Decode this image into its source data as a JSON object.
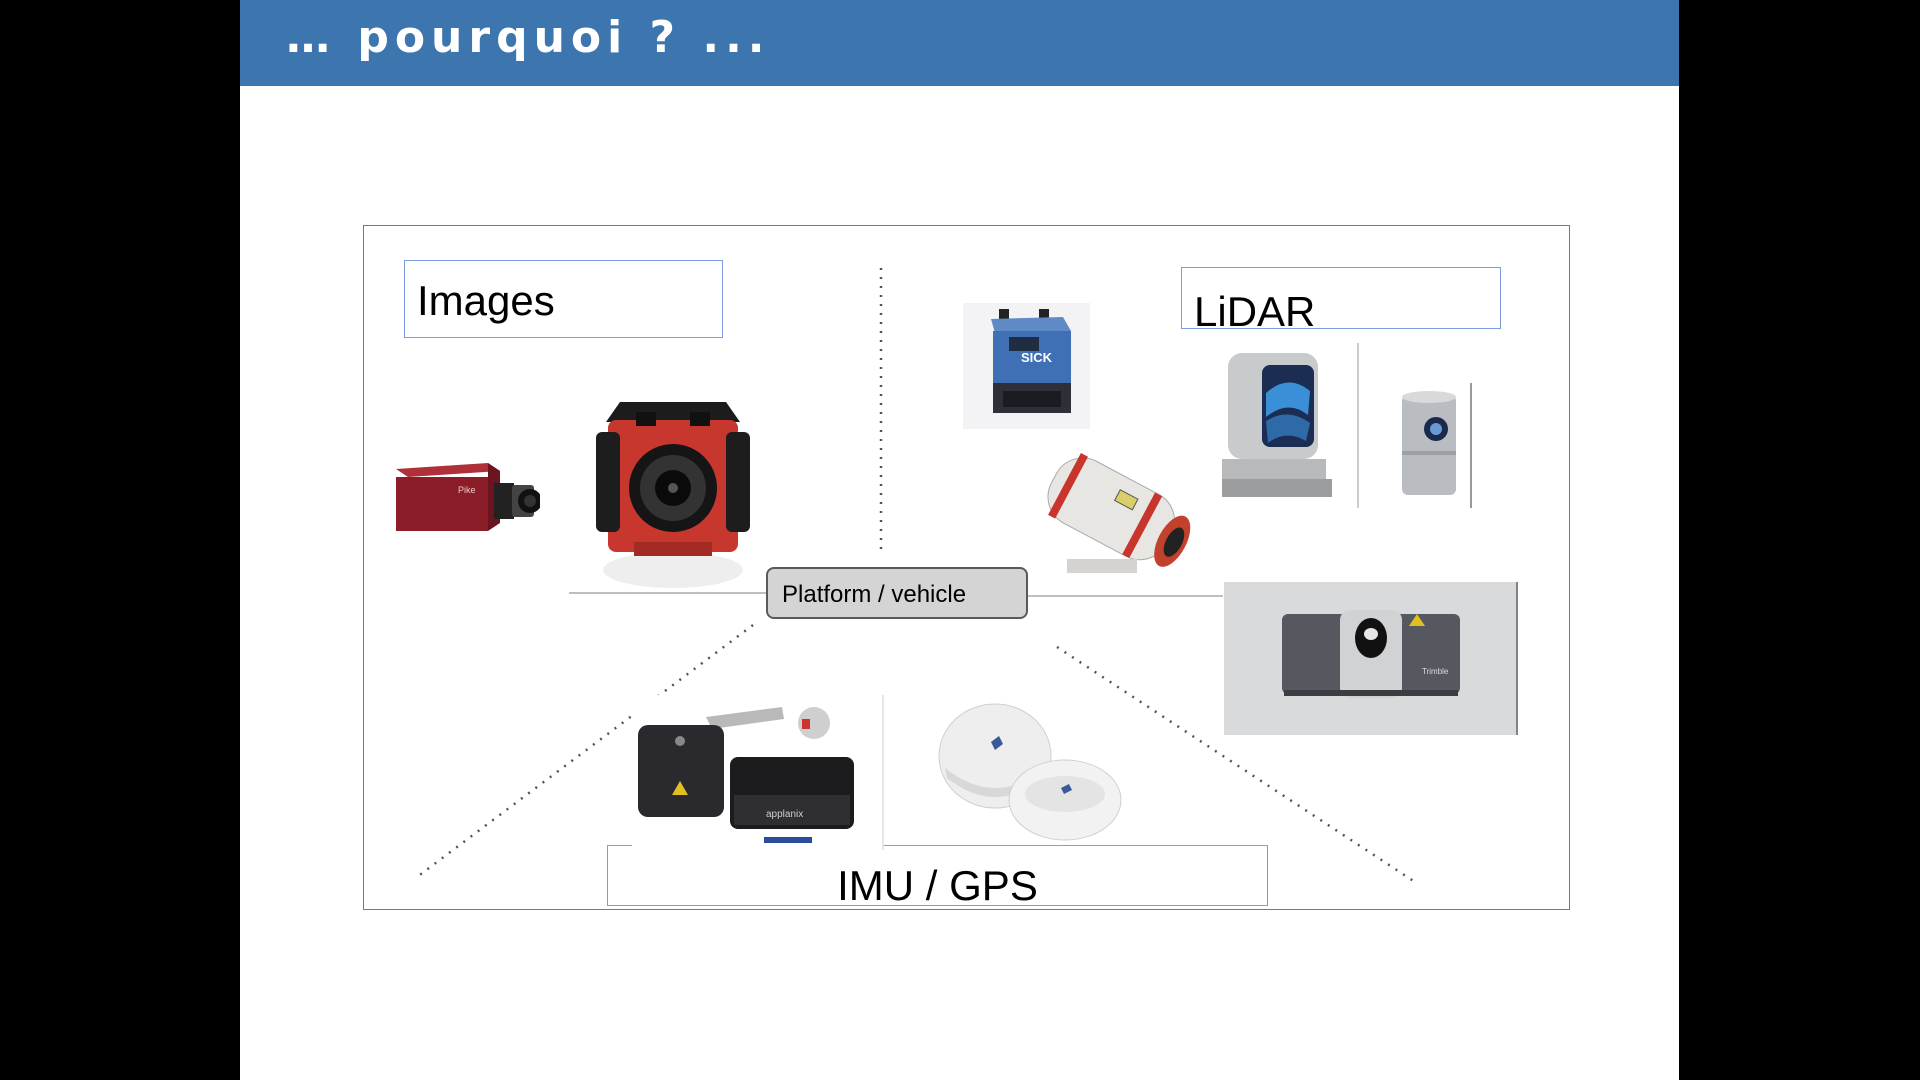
{
  "slide": {
    "title": "… pourquoi ? ...",
    "background": "#ffffff",
    "title_bar_color": "#3d76ae"
  },
  "diagram": {
    "images_label": "Images",
    "lidar_label": "LiDAR",
    "imu_gps_label": "IMU / GPS",
    "platform_label": "Platform / vehicle",
    "box_border_color": "#7c9ee0"
  },
  "devices": {
    "camera_brand": "Pike",
    "laser_brand": "SICK",
    "imu_brand": "applanix",
    "scanner_brand": "Trimble"
  }
}
